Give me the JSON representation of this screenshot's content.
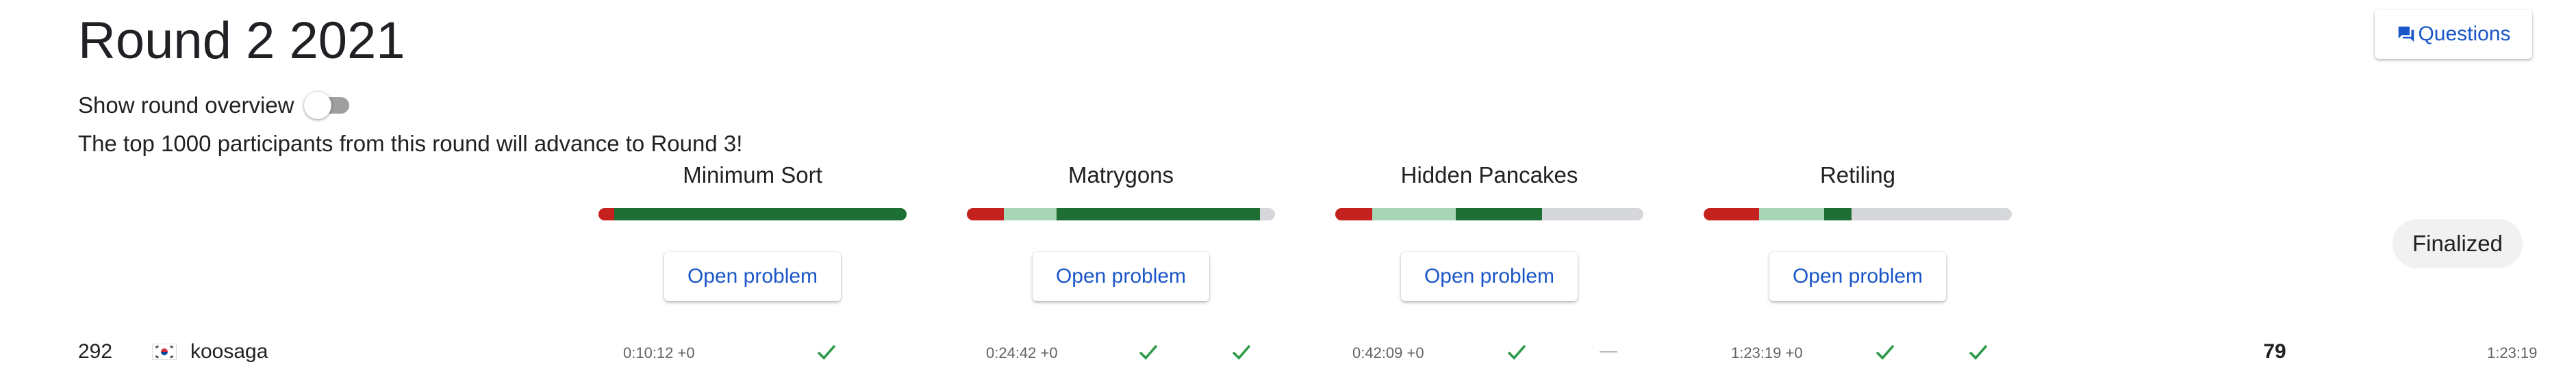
{
  "header": {
    "title": "Round 2 2021",
    "questions_label": "Questions",
    "questions_icon": "forum-icon"
  },
  "overview": {
    "label": "Show round overview",
    "toggle_on": false
  },
  "advance_note": "The top 1000 participants from this round will advance to Round 3!",
  "colors": {
    "accent": "#1a56c7",
    "failed": "#c5221f",
    "partial": "#a8d5b5",
    "solved": "#1e6f34",
    "unattempted": "#d6d7da",
    "check": "#2e9a4a"
  },
  "problems": [
    {
      "name": "Minimum Sort",
      "open_label": "Open problem",
      "progress": {
        "red": 0.05,
        "light": 0.0,
        "dark": 0.95
      }
    },
    {
      "name": "Matrygons",
      "open_label": "Open problem",
      "progress": {
        "red": 0.12,
        "light": 0.17,
        "dark": 0.66
      }
    },
    {
      "name": "Hidden Pancakes",
      "open_label": "Open problem",
      "progress": {
        "red": 0.12,
        "light": 0.27,
        "dark": 0.28
      }
    },
    {
      "name": "Retiling",
      "open_label": "Open problem",
      "progress": {
        "red": 0.18,
        "light": 0.21,
        "dark": 0.09
      }
    }
  ],
  "status_badge": "Finalized",
  "row": {
    "rank": "292",
    "country": "South Korea",
    "username": "koosaga",
    "score": "79",
    "total_time": "1:23:19",
    "results": [
      {
        "time": "0:10:12 +0",
        "tests": [
          "check"
        ]
      },
      {
        "time": "0:24:42 +0",
        "tests": [
          "check",
          "check"
        ]
      },
      {
        "time": "0:42:09 +0",
        "tests": [
          "check",
          "dash"
        ]
      },
      {
        "time": "1:23:19 +0",
        "tests": [
          "check",
          "check"
        ]
      }
    ]
  }
}
